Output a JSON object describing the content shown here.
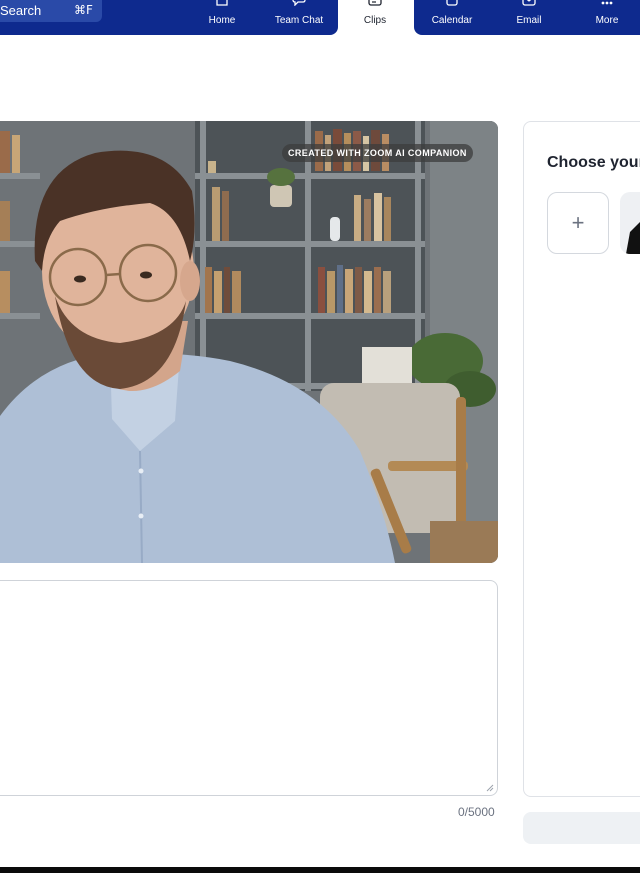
{
  "search": {
    "label": "Search",
    "shortcut": "⌘F"
  },
  "nav": {
    "items": [
      {
        "label": "Home",
        "icon": "home-icon"
      },
      {
        "label": "Team Chat",
        "icon": "chat-icon"
      },
      {
        "label": "Clips",
        "icon": "clips-icon",
        "active": true
      },
      {
        "label": "Calendar",
        "icon": "calendar-icon"
      },
      {
        "label": "Email",
        "icon": "email-icon"
      },
      {
        "label": "More",
        "icon": "more-icon"
      }
    ]
  },
  "video": {
    "badge": "CREATED WITH ZOOM AI COMPANION"
  },
  "script": {
    "value": "",
    "char_count": "0/5000"
  },
  "avatar_panel": {
    "title": "Choose your",
    "add_symbol": "+"
  },
  "colors": {
    "nav_bg": "#0e2a8e",
    "panel_border": "#dfe2e7",
    "muted_text": "#6b7280"
  }
}
